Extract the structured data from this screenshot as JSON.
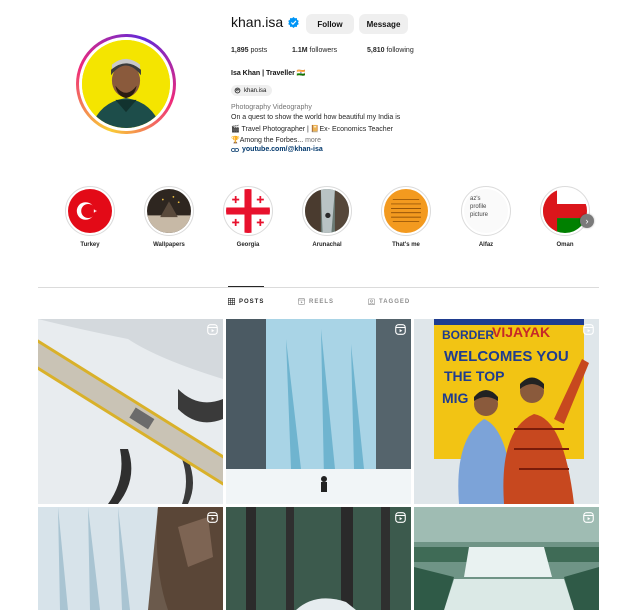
{
  "profile": {
    "username": "khan.isa",
    "follow_label": "Follow",
    "message_label": "Message",
    "stats": {
      "posts_count": "1,895",
      "posts_label": " posts",
      "followers_count": "1.1M",
      "followers_label": " followers",
      "following_count": "5,810",
      "following_label": " following"
    },
    "full_name": "Isa Khan | Traveller 🇮🇳",
    "threads_handle": "khan.isa",
    "category": "Photography Videography",
    "bio": {
      "line1": "On a quest to show the world how beautiful my India is",
      "line2": "🎬 Travel Photographer | 📔Ex- Economics Teacher",
      "line3": "🏆Among the Forbes...",
      "more": " more"
    },
    "link": "youtube.com/@khan-isa"
  },
  "highlights": [
    {
      "label": "Turkey"
    },
    {
      "label": "Wallpapers"
    },
    {
      "label": "Georgia"
    },
    {
      "label": "Arunachal"
    },
    {
      "label": "That's me"
    },
    {
      "label": "Alfaz",
      "thumb_text": [
        "az's",
        "profile",
        "picture"
      ]
    },
    {
      "label": "Oman"
    }
  ],
  "highlights_next": "›",
  "tabs": {
    "posts": "POSTS",
    "reels": "REELS",
    "tagged": "TAGGED"
  },
  "posts_grid": {
    "sign_text": [
      "BORDER",
      "VIJAYAK",
      "WELCOMES YOU",
      "THE TOP",
      "MIG"
    ],
    "items": [
      {
        "subject": "snowy bridge aerial",
        "reel": true
      },
      {
        "subject": "frozen waterfall",
        "reel": true
      },
      {
        "subject": "couple at border sign",
        "reel": true
      },
      {
        "subject": "icy cliffs",
        "reel": true
      },
      {
        "subject": "forest path",
        "reel": true
      },
      {
        "subject": "cascading waterfall",
        "reel": true
      }
    ]
  },
  "colors": {
    "verified_blue": "#0095f6",
    "link_blue": "#00376b",
    "button_grey": "#efefef"
  }
}
